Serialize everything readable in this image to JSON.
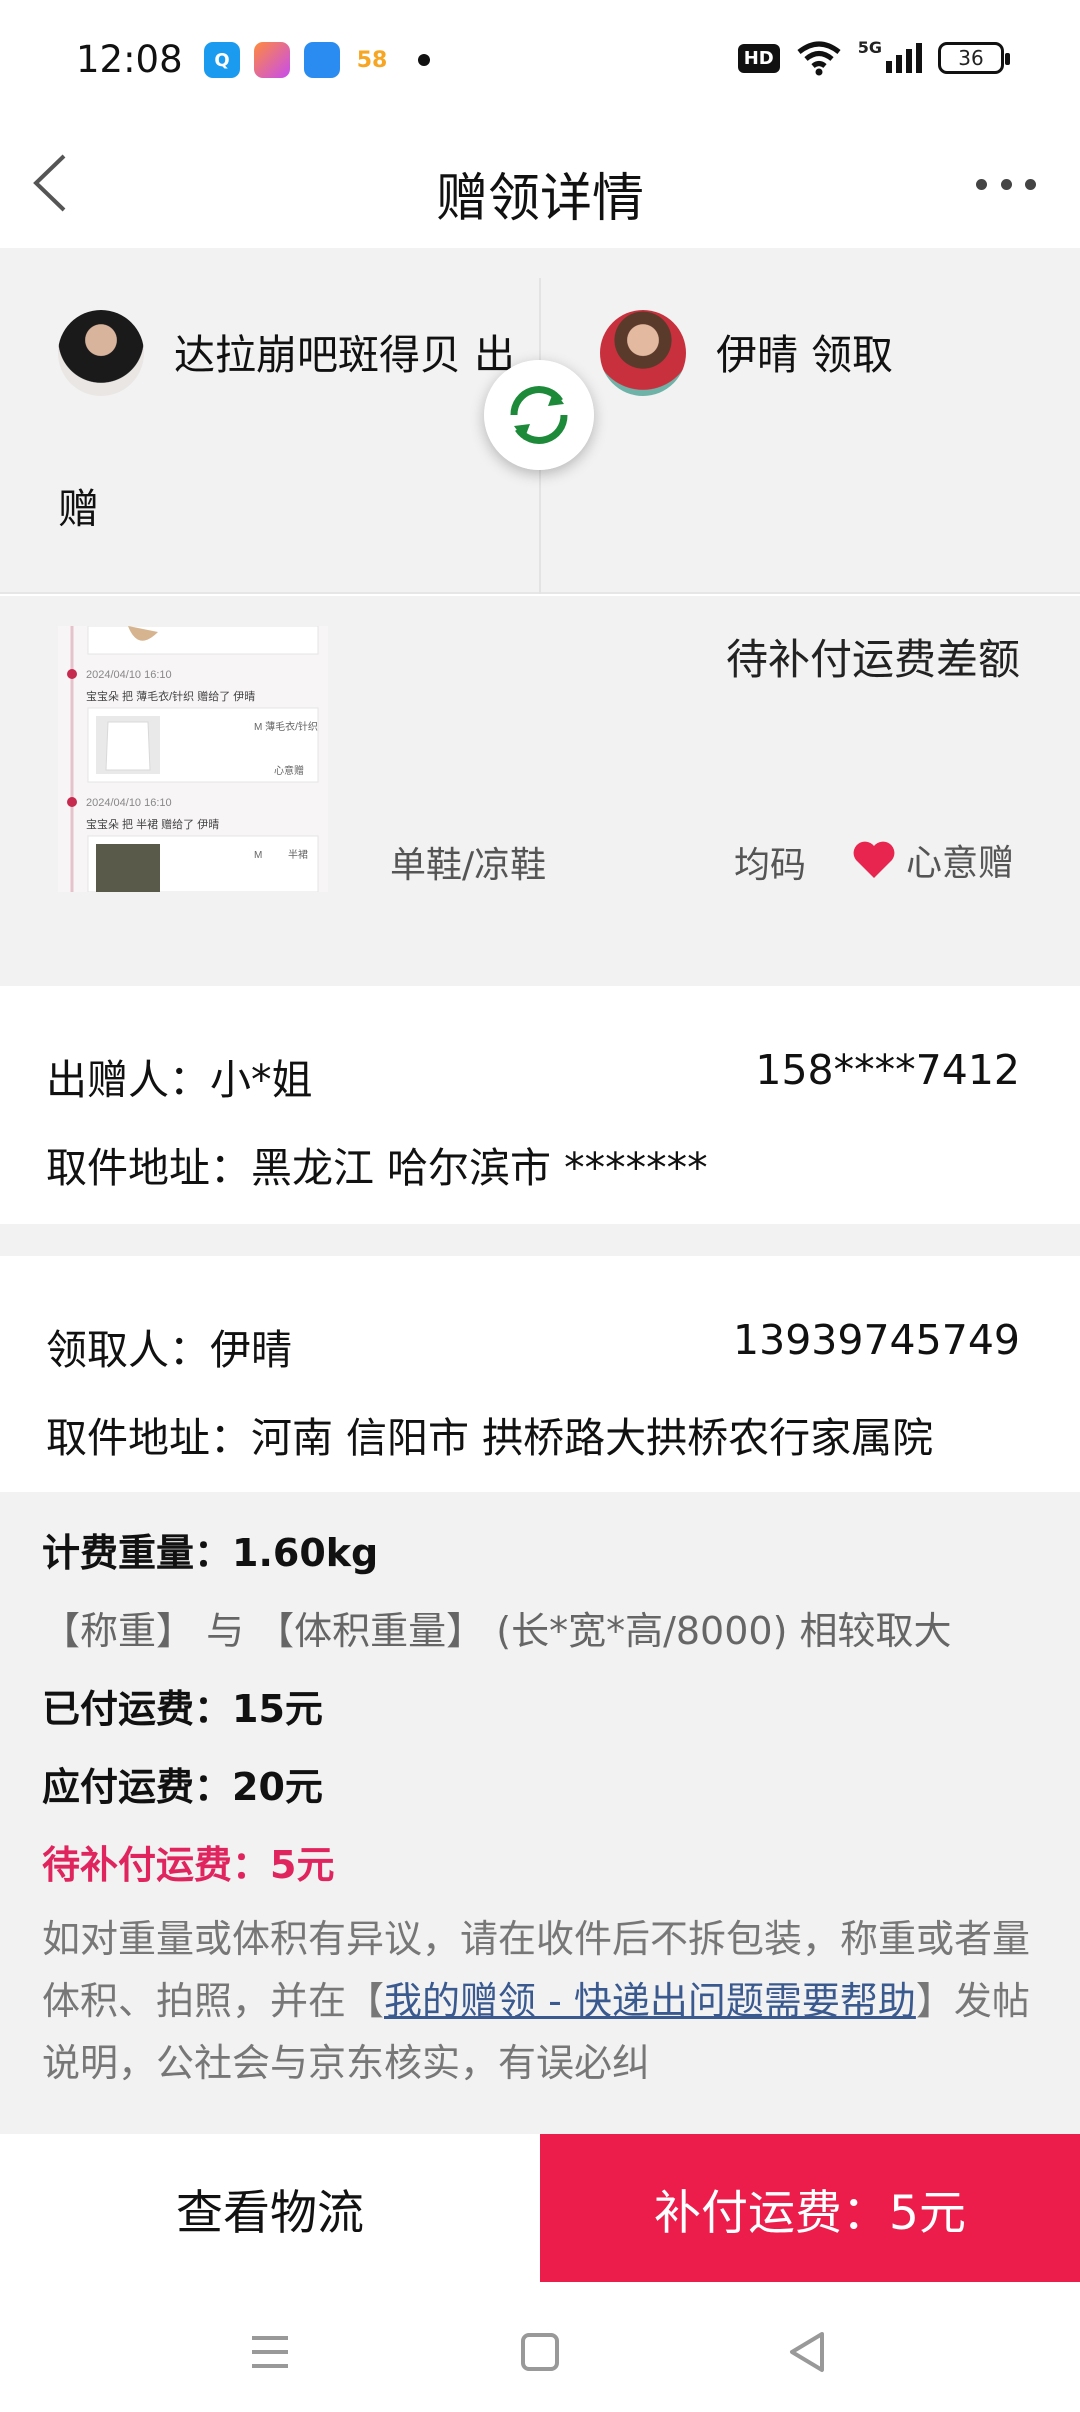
{
  "status_bar": {
    "time": "12:08",
    "apps": [
      {
        "icon": "search-app-icon",
        "label": "Q",
        "color": "#1a9bf0"
      },
      {
        "icon": "app-icon",
        "label": "",
        "color": "#ff5a4a"
      },
      {
        "icon": "app-icon",
        "label": "",
        "color": "#2a8cf0"
      },
      {
        "icon": "app-icon",
        "label": "58",
        "color": "#f6a623"
      }
    ],
    "hd_label": "HD",
    "network_label": "5G",
    "battery": "36"
  },
  "header": {
    "title": "赠领详情"
  },
  "parties": {
    "giver_name": "达拉崩吧斑得贝 出",
    "giver_name_wrap": "赠",
    "receiver_name": "伊晴 领取"
  },
  "item": {
    "status": "待补付运费差额",
    "category": "单鞋/凉鞋",
    "size": "均码",
    "tag": "心意赠",
    "thumb_lines": [
      "2024/04/10 16:10",
      "宝宝朵 把 薄毛衣/针织 赠给了 伊晴",
      "M 薄毛衣/针织",
      "心意赠",
      "2024/04/10 16:10",
      "宝宝朵 把 半裙 赠给了 伊晴",
      "M",
      "半裙"
    ]
  },
  "sender": {
    "label": "出赠人：",
    "name": "小*姐",
    "phone": "158****7412",
    "address_label": "取件地址：",
    "address": "黑龙江 哈尔滨市 *******"
  },
  "receiver": {
    "label": "领取人：",
    "name": "伊晴",
    "phone": "13939745749",
    "address_label": "取件地址：",
    "address": "河南 信阳市 拱桥路大拱桥农行家属院"
  },
  "fee": {
    "weight": "计费重量：1.60kg",
    "rule": "【称重】 与 【体积重量】 (长*宽*高/8000) 相较取大",
    "paid": "已付运费：15元",
    "due": "应付运费：20元",
    "pending": "待补付运费：5元",
    "note_before": "如对重量或体积有异议，请在收件后不拆包装，称重或者量体积、拍照，并在【",
    "note_link": "我的赠领 - 快递出问题需要帮助",
    "note_after": "】发帖说明，公社会与京东核实，有误必纠"
  },
  "actions": {
    "view_logistics": "查看物流",
    "pay_shipping": "补付运费：5元"
  },
  "colors": {
    "accent": "#ec1c4b",
    "link": "#3a5a8f",
    "background_grey": "#f2f2f2"
  }
}
